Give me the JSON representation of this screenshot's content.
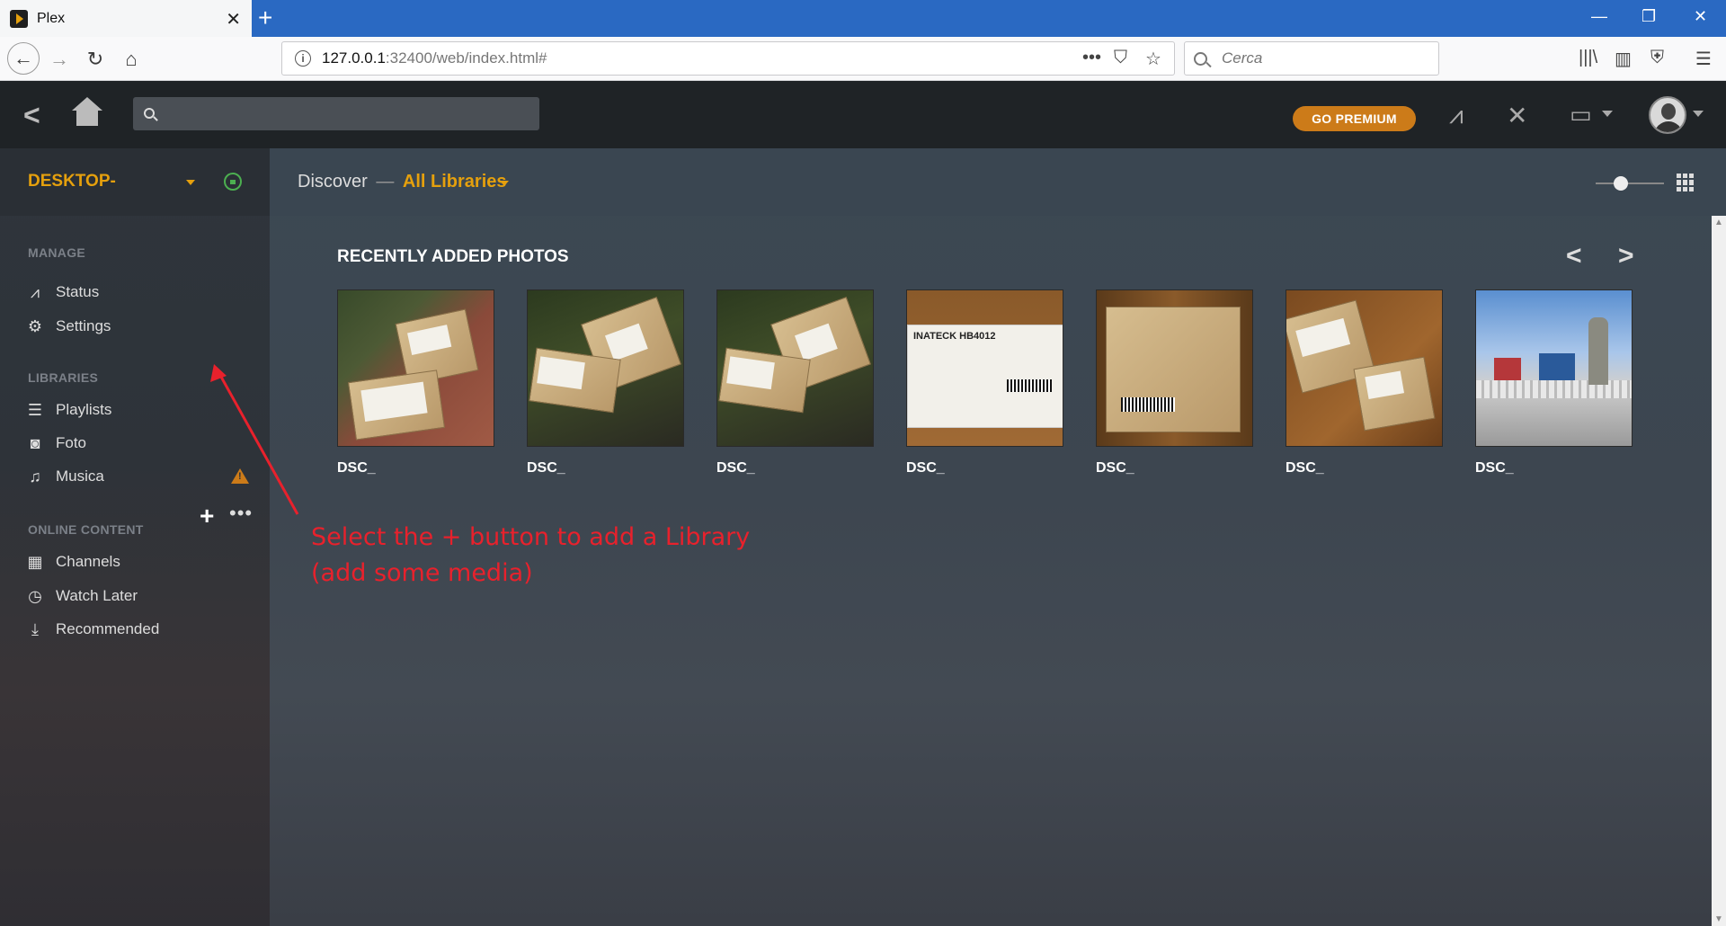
{
  "browser": {
    "tab_title": "Plex",
    "url_host": "127.0.0.1",
    "url_rest": ":32400/web/index.html#",
    "search_placeholder": "Cerca"
  },
  "header": {
    "premium_label": "GO PREMIUM"
  },
  "sidebar": {
    "server_name": "DESKTOP-",
    "manage_title": "MANAGE",
    "manage_items": [
      {
        "label": "Status",
        "icon": "activity-icon"
      },
      {
        "label": "Settings",
        "icon": "gear-icon"
      }
    ],
    "libraries_title": "LIBRARIES",
    "library_items": [
      {
        "label": "Playlists",
        "icon": "list-icon"
      },
      {
        "label": "Foto",
        "icon": "camera-icon"
      },
      {
        "label": "Musica",
        "icon": "music-icon"
      }
    ],
    "online_title": "ONLINE CONTENT",
    "online_items": [
      {
        "label": "Channels",
        "icon": "grid-icon"
      },
      {
        "label": "Watch Later",
        "icon": "clock-icon"
      },
      {
        "label": "Recommended",
        "icon": "download-icon"
      }
    ]
  },
  "main": {
    "discover_label": "Discover",
    "dash": "—",
    "all_libraries": "All Libraries",
    "section_title": "RECENTLY ADDED PHOTOS",
    "photos": [
      {
        "label": "DSC_"
      },
      {
        "label": "DSC_"
      },
      {
        "label": "DSC_"
      },
      {
        "label": "DSC_"
      },
      {
        "label": "DSC_"
      },
      {
        "label": "DSC_"
      },
      {
        "label": "DSC_"
      }
    ]
  },
  "annotation": {
    "line1": "Select the + button to add a Library",
    "line2": "(add some media)",
    "color": "#e8212c"
  },
  "colors": {
    "accent": "#e5a00d",
    "premium": "#cc7b19",
    "browser_blue": "#2a69c2"
  }
}
